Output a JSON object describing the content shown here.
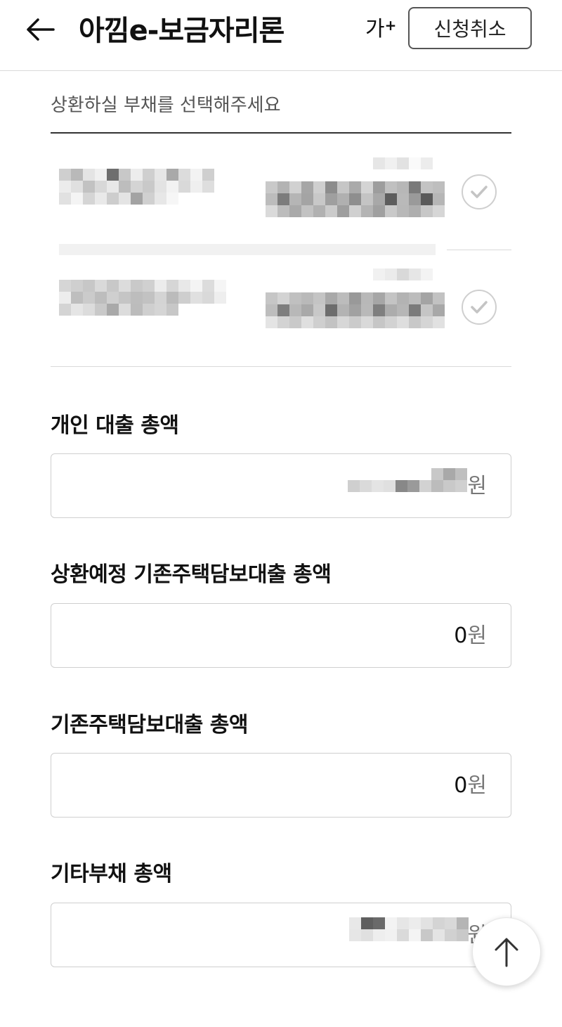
{
  "header": {
    "title": "아낌e-보금자리론",
    "font_size_label": "가",
    "font_size_plus": "+",
    "cancel_label": "신청취소"
  },
  "debt_select": {
    "hint": "상환하실 부채를 선택해주세요"
  },
  "fields": [
    {
      "label": "개인 대출 총액",
      "value": "",
      "unit": "원"
    },
    {
      "label": "상환예정 기존주택담보대출 총액",
      "value": "0",
      "unit": "원"
    },
    {
      "label": "기존주택담보대출 총액",
      "value": "0",
      "unit": "원"
    },
    {
      "label": "기타부채 총액",
      "value": "",
      "unit": "원"
    }
  ],
  "icons": {
    "back": "arrow-left-icon",
    "check": "check-circle-icon",
    "scroll_top": "arrow-up-icon"
  },
  "colors": {
    "border": "#cfcfcf",
    "text": "#111111",
    "hint": "#555555"
  }
}
